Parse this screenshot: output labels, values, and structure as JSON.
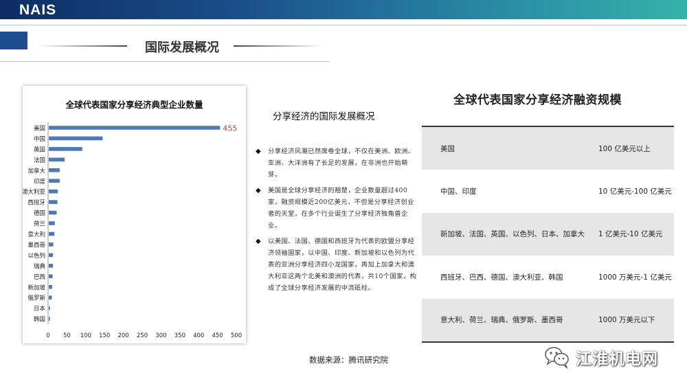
{
  "header": {
    "logo": "NAIS",
    "section_title": "国际发展概况"
  },
  "chart_data": {
    "type": "bar",
    "title": "全球代表国家分享经济典型企业数量",
    "categories": [
      "美国",
      "中国",
      "英国",
      "法国",
      "加拿大",
      "印度",
      "澳大利亚",
      "西班牙",
      "德国",
      "荷兰",
      "意大利",
      "墨西哥",
      "以色列",
      "瑞典",
      "巴西",
      "新加坡",
      "俄罗斯",
      "日本",
      "韩国"
    ],
    "values": [
      455,
      143,
      89,
      42,
      29,
      29,
      24,
      23,
      21,
      16,
      15,
      12,
      11,
      11,
      10,
      9,
      8,
      3,
      3
    ],
    "data_labels": [
      {
        "category": "美国",
        "text": "455"
      }
    ],
    "xlim": [
      0,
      500
    ],
    "xticks": [
      0,
      50,
      100,
      150,
      200,
      250,
      300,
      350,
      400,
      450,
      500
    ],
    "colors": {
      "bar": "#4f79b4",
      "label": "#c0392b"
    },
    "grid": false
  },
  "middle": {
    "heading": "分享经济的国际发展概况",
    "bullet_mark": "◆",
    "bullets": [
      "分享经济风潮已然席卷全球，不仅在美洲、欧洲、亚洲、大洋洲有了长足的发展，在非洲也开始萌芽。",
      "美国是全球分享经济的翘楚，企业数量超过400家，融资规模近200亿美元，不但是分享经济创业者的天堂，在多个行业诞生了分享经济独角兽企业。",
      "以美国、法国、德国和西班牙为代表的欧盟分享经济领袖国家，以中国、印度、新加坡和以色列为代表的亚洲分享经济四小龙国家，再加上加拿大和澳大利亚这两个北美和澳洲的代表，共10个国家，构成了全球分享经济发展的中流砥柱。"
    ],
    "source": "数据来源：腾讯研究院"
  },
  "table": {
    "title": "全球代表国家分享经济融资规模",
    "rows": [
      {
        "countries": "美国",
        "amount": "100 亿美元以上"
      },
      {
        "countries": "中国、印度",
        "amount": "10 亿美元-100 亿美元"
      },
      {
        "countries": "新加坡、法国、英国、以色列、日本、加拿大",
        "amount": "1 亿美元-10 亿美元"
      },
      {
        "countries": "西班牙、巴西、德国、澳大利亚、韩国",
        "amount": "1000 万美元-1 亿美元"
      },
      {
        "countries": "意大利、荷兰、瑞典、俄罗斯、墨西哥",
        "amount": "1000 万美元以下"
      }
    ]
  },
  "watermark": {
    "text": "江淮机电网",
    "icon": "wechat-icon"
  }
}
